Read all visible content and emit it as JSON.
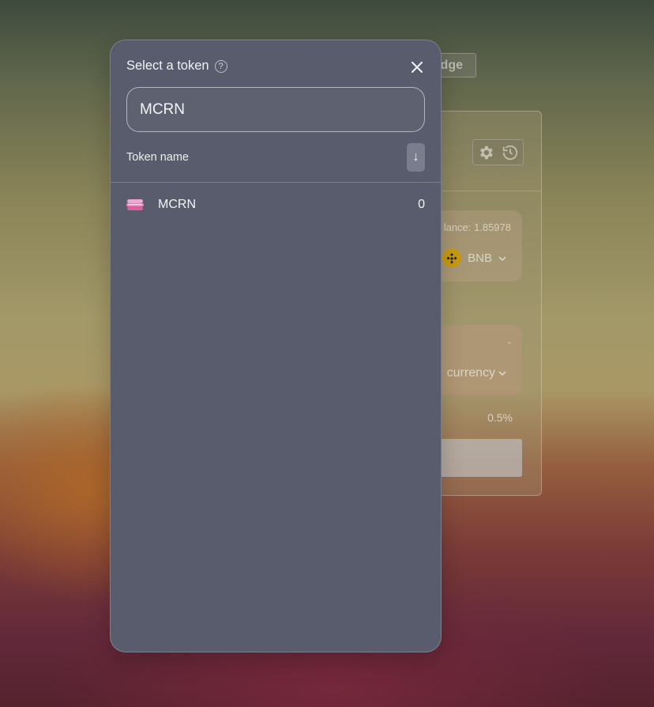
{
  "background": {
    "bridge_label": "dge",
    "balance_label": "lance: 1.85978",
    "from_token": "BNB",
    "to_dash": "-",
    "to_token": "currency",
    "slippage": "0.5%"
  },
  "modal": {
    "title": "Select a token",
    "search": {
      "value": "MCRN"
    },
    "list_header": "Token name",
    "sort_symbol": "↓",
    "tokens": [
      {
        "symbol": "MCRN",
        "balance": "0"
      }
    ]
  },
  "colors": {
    "modal_bg": "#585c6c",
    "bnb_yellow": "#c79a10",
    "mcrn_pink": "#e879b8"
  },
  "icons": [
    "help-icon",
    "close-icon",
    "gear-icon",
    "history-icon",
    "bnb-icon",
    "chevron-down-icon",
    "mcrn-token-icon"
  ]
}
